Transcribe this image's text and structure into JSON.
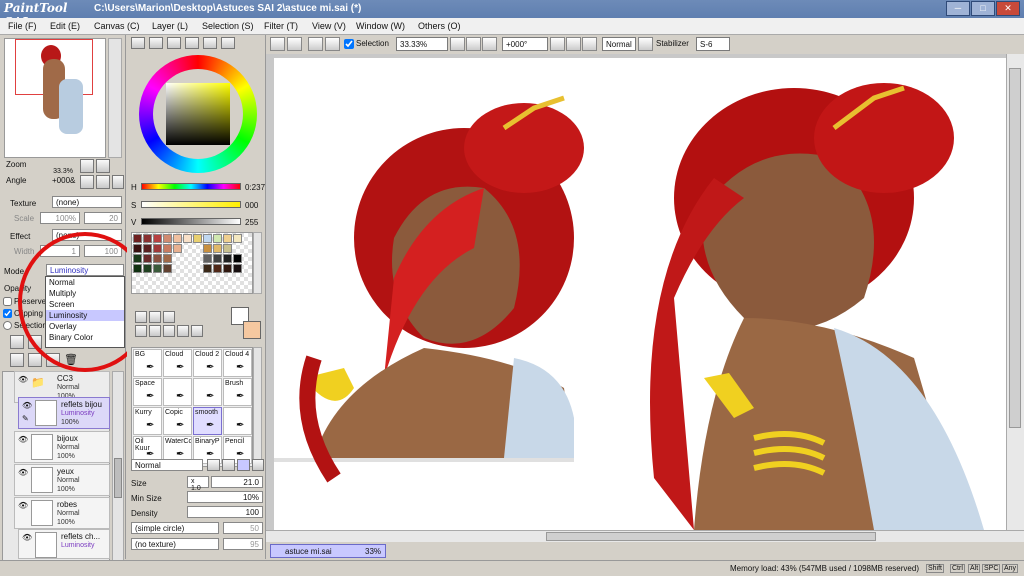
{
  "app": {
    "logo": "PaintTool SAI",
    "title": "C:\\Users\\Marion\\Desktop\\Astuces SAI 2\\astuce mi.sai (*)"
  },
  "menu": [
    "File (F)",
    "Edit (E)",
    "Canvas (C)",
    "Layer (L)",
    "Selection (S)",
    "Filter (T)",
    "View (V)",
    "Window (W)",
    "Others (O)"
  ],
  "toolbar": {
    "selection_label": "Selection",
    "zoom": "33.33%",
    "angle": "+000°",
    "mode": "Normal",
    "stabilizer_label": "Stabilizer",
    "stabilizer": "S-6"
  },
  "navigator": {
    "zoom_label": "Zoom",
    "zoom_value": "33.3%",
    "angle_label": "Angle",
    "angle_value": "+000&"
  },
  "layer_props": {
    "texture_label": "Texture",
    "texture_value": "(none)",
    "scale_label": "Scale",
    "scale_value": "100%",
    "scale_num": "20",
    "effect_label": "Effect",
    "effect_value": "(none)",
    "width_label": "Width",
    "width_value": "1",
    "width_num": "100",
    "mode_label": "Mode",
    "mode_value": "Luminosity",
    "opacity_label": "Opacity",
    "preserve_label": "Preserve",
    "clipping_label": "Clipping",
    "selection_src_label": "Selection"
  },
  "mode_options": [
    "Normal",
    "Multiply",
    "Screen",
    "Luminosity",
    "Overlay",
    "Binary Color"
  ],
  "mode_selected_index": 3,
  "layers": [
    {
      "name": "CC3",
      "mode": "Normal",
      "opacity": "100%",
      "folder": true
    },
    {
      "name": "reflets bijou",
      "mode": "Luminosity",
      "opacity": "100%",
      "active": true
    },
    {
      "name": "bijoux",
      "mode": "Normal",
      "opacity": "100%"
    },
    {
      "name": "yeux",
      "mode": "Normal",
      "opacity": "100%"
    },
    {
      "name": "robes",
      "mode": "Normal",
      "opacity": "100%"
    },
    {
      "name": "reflets ch...",
      "mode": "Luminosity",
      "opacity": "100%"
    }
  ],
  "color": {
    "h_label": "H",
    "h_value": "0:237",
    "s_label": "S",
    "s_value": "000",
    "v_label": "V",
    "v_value": "255",
    "primary": "#ffffff",
    "secondary": "#f5c8a0"
  },
  "tools": [
    {
      "name": "BG"
    },
    {
      "name": "Cloud"
    },
    {
      "name": "Cloud 2"
    },
    {
      "name": "Cloud 4"
    },
    {
      "name": "Space"
    },
    {
      "name": ""
    },
    {
      "name": ""
    },
    {
      "name": "Brush"
    },
    {
      "name": "Kurry"
    },
    {
      "name": "Copic"
    },
    {
      "name": "smooth",
      "selected": true
    },
    {
      "name": ""
    },
    {
      "name": "Oil Kuur"
    },
    {
      "name": "WaterCo"
    },
    {
      "name": "BinaryP"
    },
    {
      "name": "Pencil"
    }
  ],
  "brush": {
    "blend": "Normal",
    "size_label": "Size",
    "size_mult": "x 1.0",
    "size_value": "21.0",
    "min_size_label": "Min Size",
    "min_size_value": "10%",
    "density_label": "Density",
    "density_value": "100",
    "shape": "(simple circle)",
    "shape_num": "50",
    "texture": "(no texture)",
    "texture_num": "95"
  },
  "document_tab": {
    "name": "astuce mi.sai",
    "zoom": "33%"
  },
  "status": {
    "memory": "Memory load: 43% (547MB used / 1098MB reserved)",
    "keys": [
      "Shift",
      "Ctrl",
      "Alt",
      "SPC",
      "Any"
    ]
  },
  "colors": {
    "title_bar": "#6d8bb8",
    "highlight_circle": "#e01010",
    "active_layer": "#dcd8f8"
  }
}
